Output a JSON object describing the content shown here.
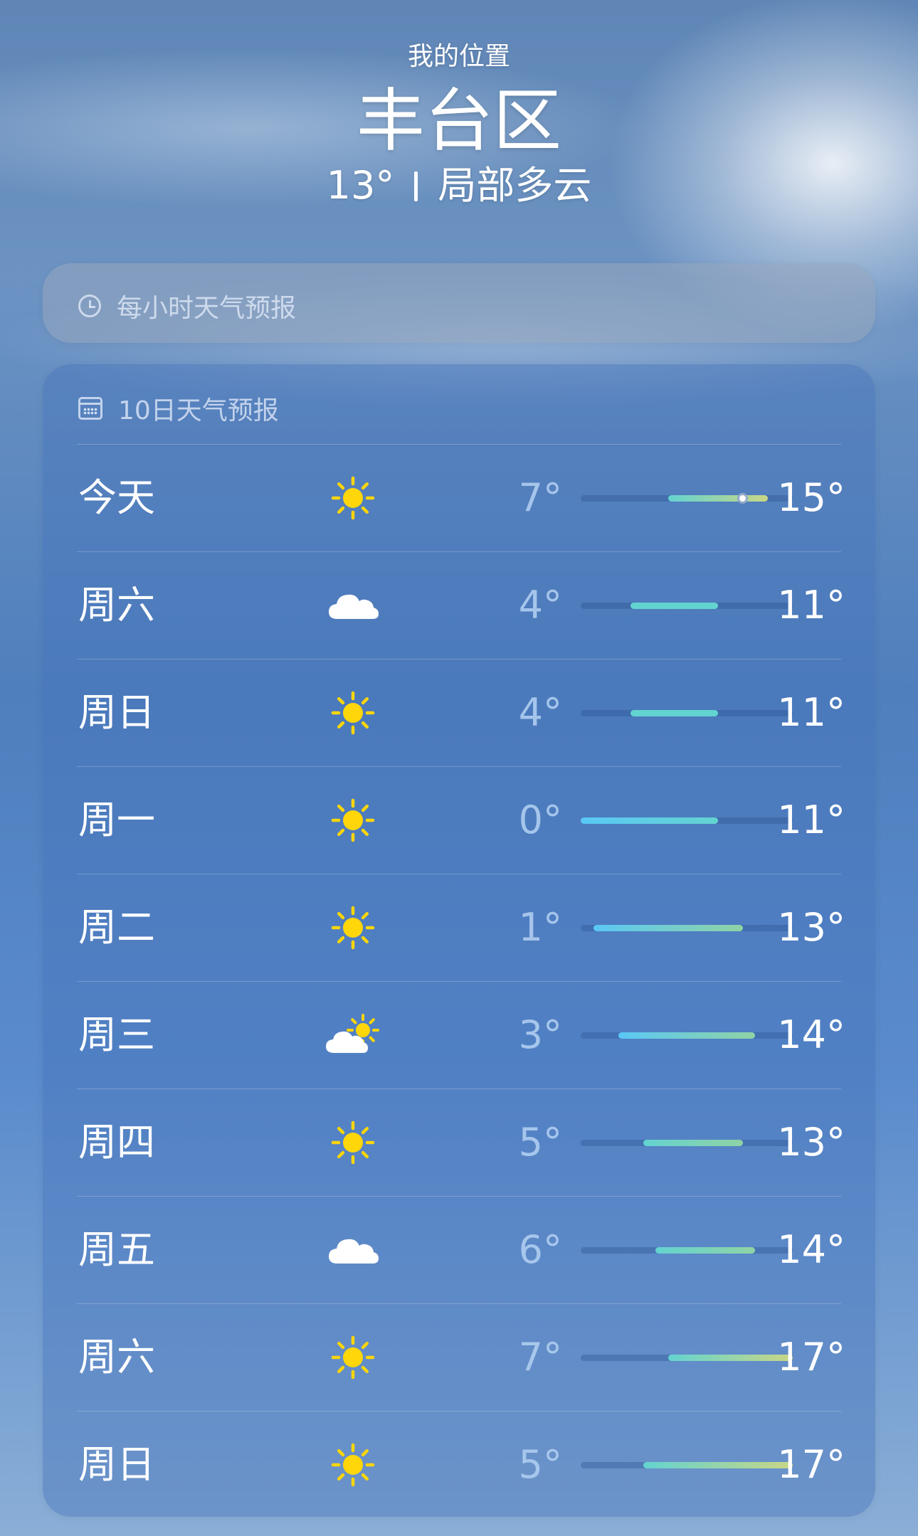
{
  "location": {
    "label": "我的位置",
    "city": "丰台区",
    "current_temp": "13°",
    "condition": "局部多云"
  },
  "hourly": {
    "title": "每小时天气预报",
    "icon": "clock-icon"
  },
  "daily": {
    "title": "10日天气预报",
    "icon": "calendar-icon",
    "range_min": 0,
    "range_max": 17,
    "current_temp_value": 13,
    "days": [
      {
        "day": "今天",
        "icon": "sun-icon",
        "low": "7°",
        "high": "15°",
        "low_value": 7,
        "high_value": 15,
        "show_current": true
      },
      {
        "day": "周六",
        "icon": "cloud-icon",
        "low": "4°",
        "high": "11°",
        "low_value": 4,
        "high_value": 11
      },
      {
        "day": "周日",
        "icon": "sun-icon",
        "low": "4°",
        "high": "11°",
        "low_value": 4,
        "high_value": 11
      },
      {
        "day": "周一",
        "icon": "sun-icon",
        "low": "0°",
        "high": "11°",
        "low_value": 0,
        "high_value": 11
      },
      {
        "day": "周二",
        "icon": "sun-icon",
        "low": "1°",
        "high": "13°",
        "low_value": 1,
        "high_value": 13
      },
      {
        "day": "周三",
        "icon": "partly-cloudy-icon",
        "low": "3°",
        "high": "14°",
        "low_value": 3,
        "high_value": 14
      },
      {
        "day": "周四",
        "icon": "sun-icon",
        "low": "5°",
        "high": "13°",
        "low_value": 5,
        "high_value": 13
      },
      {
        "day": "周五",
        "icon": "cloud-icon",
        "low": "6°",
        "high": "14°",
        "low_value": 6,
        "high_value": 14
      },
      {
        "day": "周六",
        "icon": "sun-icon",
        "low": "7°",
        "high": "17°",
        "low_value": 7,
        "high_value": 17
      },
      {
        "day": "周日",
        "icon": "sun-icon",
        "low": "5°",
        "high": "17°",
        "low_value": 5,
        "high_value": 17
      }
    ]
  },
  "colors": {
    "cold": "#5ac8f5",
    "cool": "#63d3d0",
    "mild": "#8fd3a5",
    "warm": "#c9d685",
    "sun": "#ffd60a",
    "cloud": "#ffffff"
  }
}
